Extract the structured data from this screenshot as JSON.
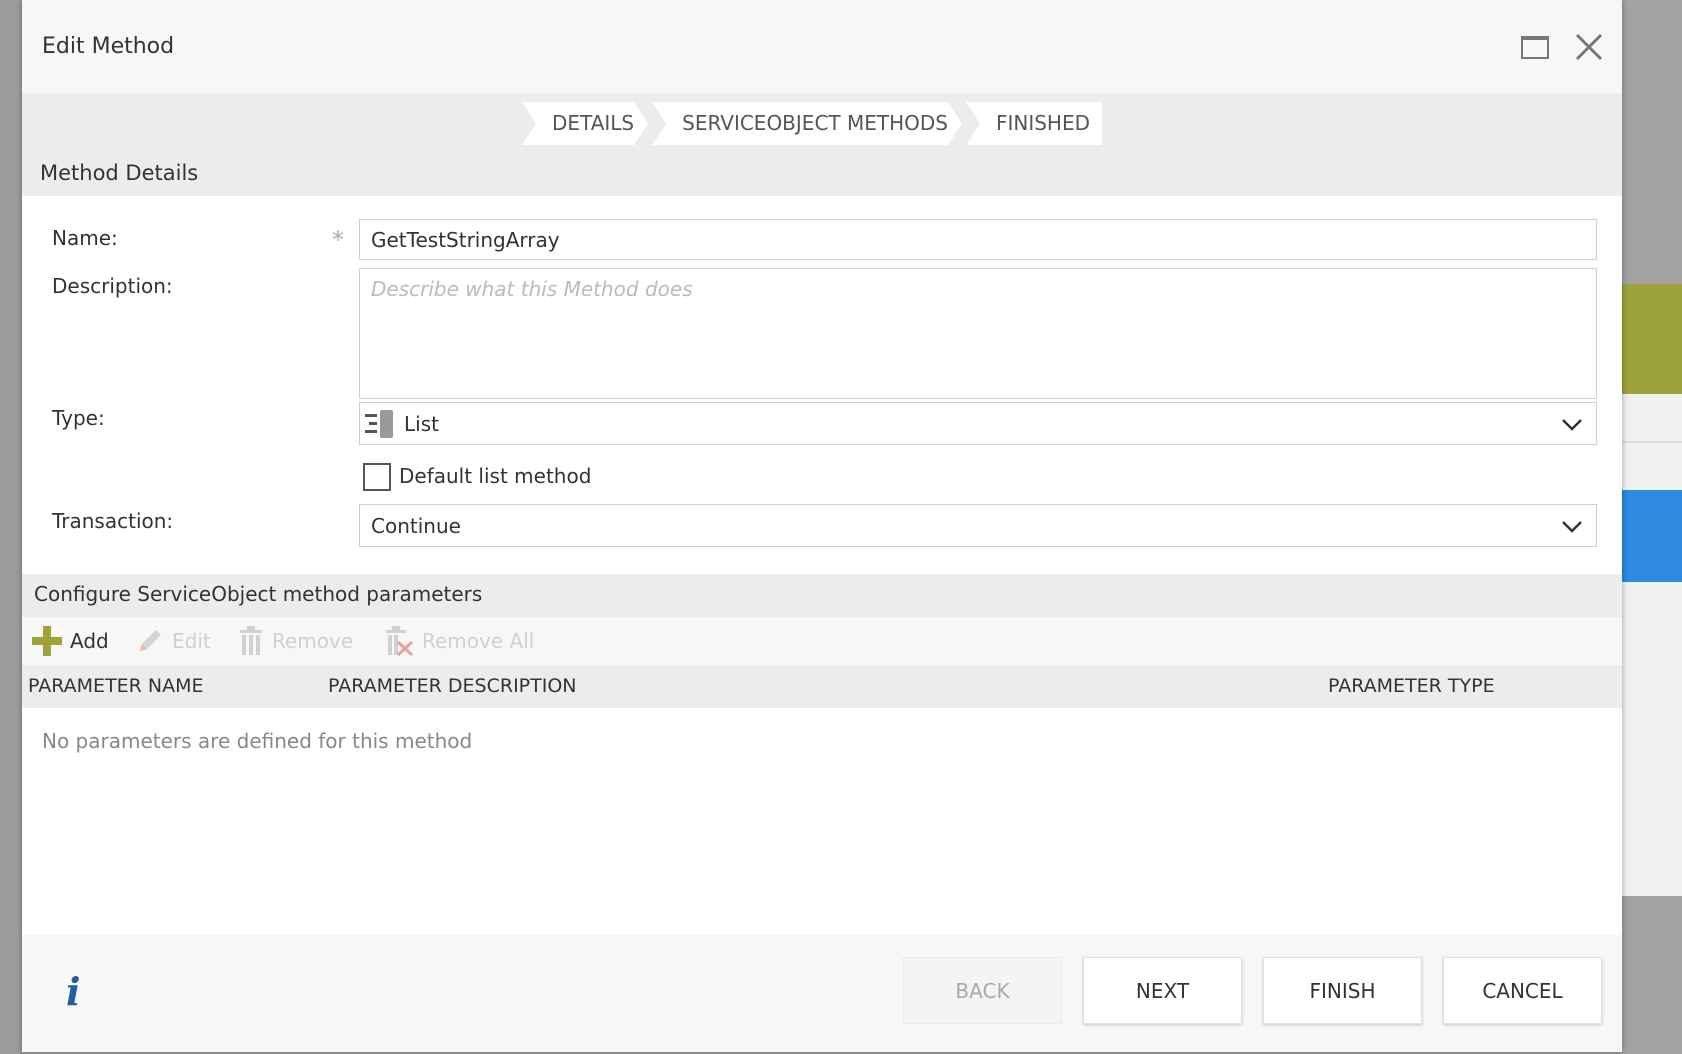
{
  "dialog": {
    "title": "Edit Method",
    "maximize_icon": "window-maximize-icon",
    "close_icon": "close-icon"
  },
  "wizard": {
    "steps": [
      "DETAILS",
      "SERVICEOBJECT METHODS",
      "FINISHED"
    ]
  },
  "method_details": {
    "section_title": "Method Details",
    "name_label": "Name:",
    "name_required_mark": "*",
    "name_value": "GetTestStringArray",
    "description_label": "Description:",
    "description_placeholder": "Describe what this Method does",
    "description_value": "",
    "type_label": "Type:",
    "type_value": "List",
    "type_icon": "list-method-icon",
    "default_list_label": "Default list method",
    "default_list_checked": false,
    "transaction_label": "Transaction:",
    "transaction_value": "Continue"
  },
  "parameters": {
    "section_title": "Configure ServiceObject method parameters",
    "toolbar": {
      "add": "Add",
      "edit": "Edit",
      "remove": "Remove",
      "remove_all": "Remove All"
    },
    "columns": [
      "PARAMETER NAME",
      "PARAMETER DESCRIPTION",
      "PARAMETER TYPE"
    ],
    "empty_message": "No parameters are defined for this method"
  },
  "footer": {
    "info_icon": "i",
    "back": "BACK",
    "next": "NEXT",
    "finish": "FINISH",
    "cancel": "CANCEL"
  },
  "colors": {
    "add_icon": "#9ea23a",
    "info_icon": "#1e5fa0",
    "background_accent_olive": "#9ea23a",
    "background_accent_blue": "#2e8ae0"
  }
}
